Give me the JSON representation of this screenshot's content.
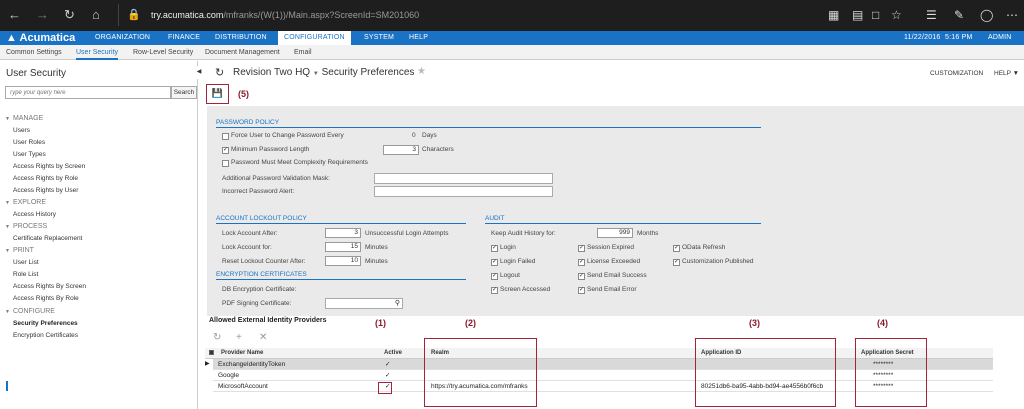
{
  "browser": {
    "url_domain": "try.acumatica.com",
    "url_path": "/mfranks/(W(1))/Main.aspx?ScreenId=SM201060"
  },
  "app": {
    "logo": "Acumatica",
    "menu": [
      "ORGANIZATION",
      "FINANCE",
      "DISTRIBUTION",
      "CONFIGURATION",
      "SYSTEM",
      "HELP"
    ],
    "date": "11/22/2016",
    "time": "5:16 PM",
    "user": "ADMIN"
  },
  "subnav": [
    "Common Settings",
    "User Security",
    "Row-Level Security",
    "Document Management",
    "Email"
  ],
  "sidebar": {
    "title": "User Security",
    "search_placeholder": "Type your query here",
    "search_button": "Search",
    "sections": [
      {
        "name": "MANAGE",
        "items": [
          "Users",
          "User Roles",
          "User Types",
          "Access Rights by Screen",
          "Access Rights by Role",
          "Access Rights by User"
        ]
      },
      {
        "name": "EXPLORE",
        "items": [
          "Access History"
        ]
      },
      {
        "name": "PROCESS",
        "items": [
          "Certificate Replacement"
        ]
      },
      {
        "name": "PRINT",
        "items": [
          "User List",
          "Role List",
          "Access Rights By Screen",
          "Access Rights By Role"
        ]
      },
      {
        "name": "CONFIGURE",
        "items": [
          "Security Preferences",
          "Encryption Certificates"
        ]
      }
    ]
  },
  "page": {
    "company": "Revision Two HQ",
    "title": "Security Preferences",
    "customization": "CUSTOMIZATION",
    "help": "HELP"
  },
  "annotations": {
    "a1": "(1)",
    "a2": "(2)",
    "a3": "(3)",
    "a4": "(4)",
    "a5": "(5)"
  },
  "password_policy": {
    "header": "PASSWORD POLICY",
    "force_change_label": "Force User to Change Password Every",
    "force_change_value": "0",
    "force_change_unit": "Days",
    "min_length_label": "Minimum Password Length",
    "min_length_value": "3",
    "min_length_unit": "Characters",
    "complexity_label": "Password Must Meet Complexity Requirements",
    "validation_mask_label": "Additional Password Validation Mask:",
    "incorrect_alert_label": "Incorrect Password Alert:"
  },
  "lockout": {
    "header": "ACCOUNT LOCKOUT POLICY",
    "lock_after_label": "Lock Account After:",
    "lock_after_value": "3",
    "lock_after_unit": "Unsuccessful Login Attempts",
    "lock_for_label": "Lock Account for:",
    "lock_for_value": "15",
    "lock_for_unit": "Minutes",
    "reset_label": "Reset Lockout Counter After:",
    "reset_value": "10",
    "reset_unit": "Minutes"
  },
  "encryption": {
    "header": "ENCRYPTION CERTIFICATES",
    "db_label": "DB Encryption Certificate:",
    "pdf_label": "PDF Signing Certificate:"
  },
  "audit": {
    "header": "AUDIT",
    "keep_label": "Keep Audit History for:",
    "keep_value": "999",
    "keep_unit": "Months",
    "col1": [
      "Login",
      "Login Failed",
      "Logout",
      "Screen Accessed"
    ],
    "col2": [
      "Session Expired",
      "License Exceeded",
      "Send Email Success",
      "Send Email Error"
    ],
    "col3": [
      "OData Refresh",
      "Customization Published"
    ]
  },
  "identity": {
    "title": "Allowed External Identity Providers",
    "columns": [
      "Provider Name",
      "Active",
      "Realm",
      "Application ID",
      "Application Secret"
    ],
    "rows": [
      {
        "provider": "ExchangeIdentityToken",
        "active": "✓",
        "realm": "",
        "app_id": "",
        "secret": "********"
      },
      {
        "provider": "Google",
        "active": "✓",
        "realm": "",
        "app_id": "",
        "secret": "********"
      },
      {
        "provider": "MicrosoftAccount",
        "active": "✓",
        "realm": "https://try.acumatica.com/mfranks",
        "app_id": "80251db6-ba95-4abb-bd94-ae4556b0f6cb",
        "secret": "********"
      }
    ]
  }
}
